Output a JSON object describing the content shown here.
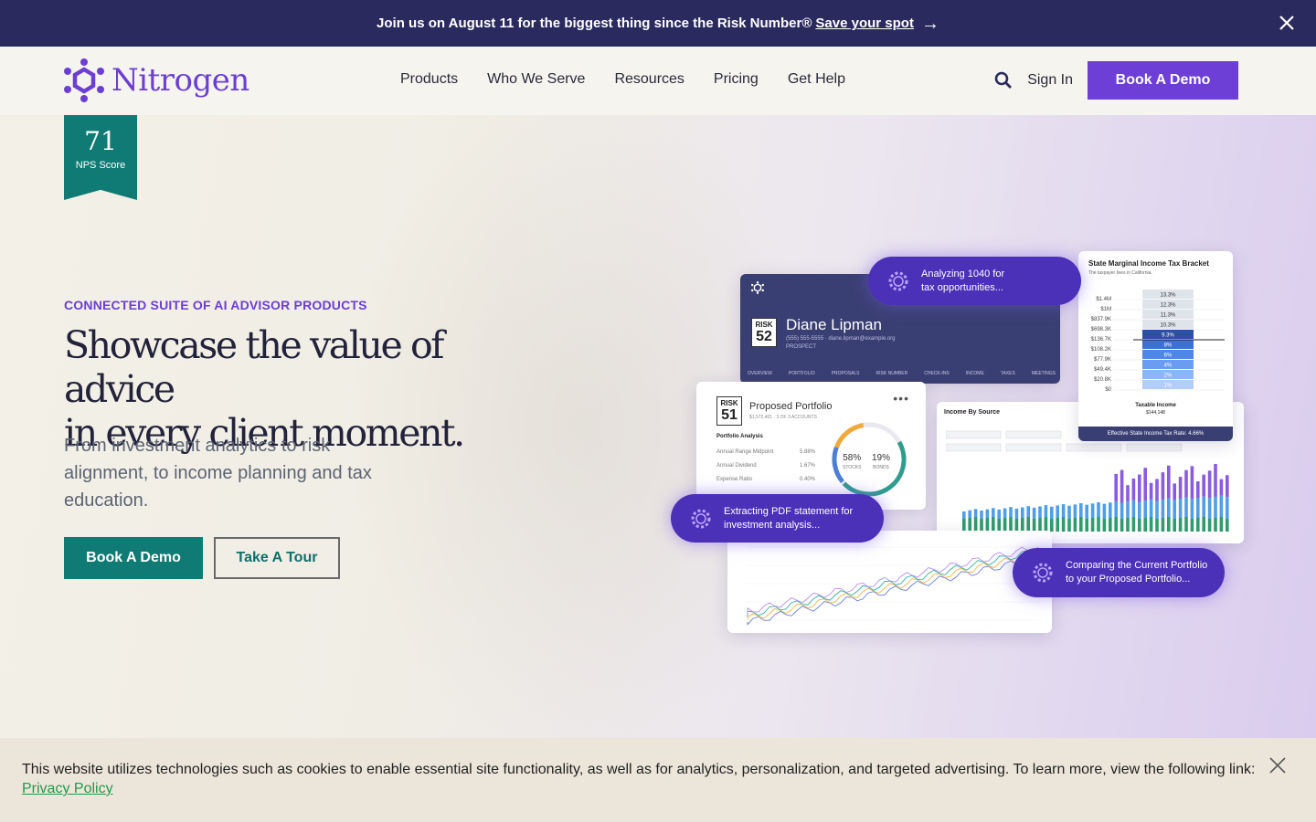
{
  "announcement": {
    "text": "Join us on August 11 for the biggest thing since the Risk Number®",
    "link": "Save your spot",
    "arrow": "→"
  },
  "nav": {
    "logo": "Nitrogen",
    "links": [
      "Products",
      "Who We Serve",
      "Resources",
      "Pricing",
      "Get Help"
    ],
    "sign_in": "Sign In",
    "cta": "Book A Demo"
  },
  "hero": {
    "nps_value": "71",
    "nps_label": "NPS Score",
    "eyebrow": "CONNECTED SUITE OF AI ADVISOR PRODUCTS",
    "headline_line1": "Showcase the value of advice",
    "headline_line2": "in every client moment.",
    "subtext": "From investment analytics to risk alignment, to income planning and tax education.",
    "primary_button": "Book A Demo",
    "secondary_button": "Take A Tour"
  },
  "mockup": {
    "client": {
      "risk_label": "RISK",
      "risk_number": "52",
      "name": "Diane Lipman",
      "meta": "(555) 555-5555 · diane.lipman@example.org",
      "status": "PROSPECT",
      "tabs": [
        "OVERVIEW",
        "PORTFOLIO",
        "PROPOSALS",
        "RISK NUMBER",
        "CHECK-INS",
        "INCOME",
        "TAXES",
        "MEETINGS"
      ]
    },
    "tax": {
      "title": "State Marginal Income Tax Bracket",
      "subtitle": "The taxpayer lives in California.",
      "incomes": [
        "$1.4M",
        "$1M",
        "$837.9K",
        "$698.3K",
        "$136.7K",
        "$108.2K",
        "$77.9K",
        "$49.4K",
        "$20.8K",
        "$0"
      ],
      "rates": [
        "13.3%",
        "12.3%",
        "11.3%",
        "10.3%",
        "9.3%",
        "8%",
        "6%",
        "4%",
        "2%",
        "1%"
      ],
      "taxable_label": "Taxable Income",
      "taxable_value": "$144,148",
      "footer": "Effective State Income Tax Rate: 4.66%"
    },
    "income": {
      "title": "Income By Source"
    },
    "portfolio": {
      "risk_label": "RISK",
      "risk_number": "51",
      "title": "Proposed Portfolio",
      "meta": "$1,572,401 · 3 OF 3 ACCOUNTS",
      "section": "Portfolio Analysis",
      "rows": [
        {
          "label": "Annual Range Midpoint",
          "value": "5.88%"
        },
        {
          "label": "Annual Dividend",
          "value": "1.67%"
        },
        {
          "label": "Expense Ratio",
          "value": "0.40%"
        }
      ],
      "stocks_pct": "58%",
      "stocks_label": "STOCKS",
      "bonds_pct": "19%",
      "bonds_label": "BONDS",
      "menu": "•••"
    },
    "pills": [
      {
        "line1": "Analyzing 1040 for",
        "line2": "tax opportunities..."
      },
      {
        "line1": "Extracting PDF statement for",
        "line2": "investment analysis..."
      },
      {
        "line1": "Comparing the Current Portfolio",
        "line2": "to your Proposed Portfolio..."
      }
    ]
  },
  "cookie": {
    "text": "This website utilizes technologies such as cookies to enable essential site functionality, as well as for analytics, personalization, and targeted advertising. To learn more, view the following link:",
    "link": "Privacy Policy"
  },
  "colors": {
    "announcement_bg": "#2b2a5e",
    "brand_purple": "#6d3fd6",
    "teal": "#0f7b74",
    "pill_purple": "#4b30b8"
  }
}
